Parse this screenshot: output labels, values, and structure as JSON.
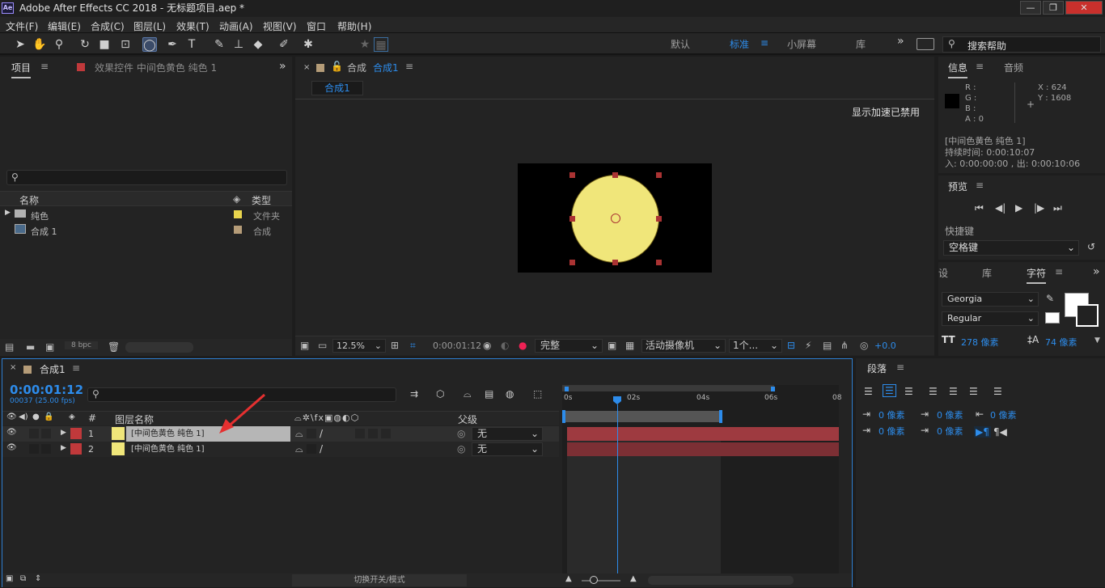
{
  "window": {
    "title": "Adobe After Effects CC 2018 - 无标题项目.aep *",
    "logo_text": "Ae",
    "min": "—",
    "max": "❐",
    "close": "✕"
  },
  "menu": [
    "文件(F)",
    "编辑(E)",
    "合成(C)",
    "图层(L)",
    "效果(T)",
    "动画(A)",
    "视图(V)",
    "窗口",
    "帮助(H)"
  ],
  "workspaces": {
    "default": "默认",
    "standard": "标准",
    "small": "小屏幕",
    "library": "库",
    "more": "»",
    "search_placeholder": "搜索帮助"
  },
  "project": {
    "tab": "项目",
    "effects_tab": "效果控件 中间色黄色 纯色 1",
    "search_placeholder": "",
    "col_name": "名称",
    "col_type": "类型",
    "items": [
      {
        "name": "纯色",
        "type": "文件夹",
        "color": "#e8d44d"
      },
      {
        "name": "合成 1",
        "type": "合成",
        "color": "#b59c78"
      }
    ],
    "bpc": "8 bpc"
  },
  "composition": {
    "tab_prefix": "合成",
    "tab_name": "合成1",
    "flow_tab": "合成1",
    "accel_notice": "显示加速已禁用",
    "zoom": "12.5%",
    "timecode": "0:00:01:12",
    "quality": "完整",
    "camera": "活动摄像机",
    "views": "1个...",
    "exposure": "+0.0",
    "solid_color": "#f0e67a"
  },
  "info": {
    "tab": "信息",
    "audio_tab": "音频",
    "r": "R :",
    "g": "G :",
    "b": "B :",
    "a": "A : 0",
    "x": "X : 624",
    "y": "Y : 1608",
    "layer": "[中间色黄色 纯色 1]",
    "duration": "持续时间: 0:00:10:07",
    "inout": "入: 0:00:00:00 , 出: 0:00:10:06"
  },
  "preview": {
    "tab": "预览",
    "shortcut_label": "快捷键",
    "shortcut_value": "空格键"
  },
  "character": {
    "tab_a": "设",
    "tab_b": "库",
    "tab": "字符",
    "font": "Georgia",
    "style": "Regular",
    "size": "278 像素",
    "leading": "74 像素"
  },
  "paragraph": {
    "tab": "段落",
    "indent_value": "0 像素"
  },
  "timeline": {
    "tab": "合成1",
    "timecode": "0:00:01:12",
    "frames": "00037 (25.00 fps)",
    "search_placeholder": "",
    "col_num": "#",
    "col_layer": "图层名称",
    "col_parent": "父级",
    "layers": [
      {
        "num": "1",
        "name": "[中间色黄色 纯色 1]",
        "parent": "无",
        "selected": true
      },
      {
        "num": "2",
        "name": "[中间色黄色 纯色 1]",
        "parent": "无",
        "selected": false
      }
    ],
    "ruler": [
      "0s",
      "02s",
      "04s",
      "06s",
      "08"
    ],
    "toggle_label": "切换开关/模式",
    "label_color": "#c0393b",
    "bar_color": "#9e3a40"
  }
}
